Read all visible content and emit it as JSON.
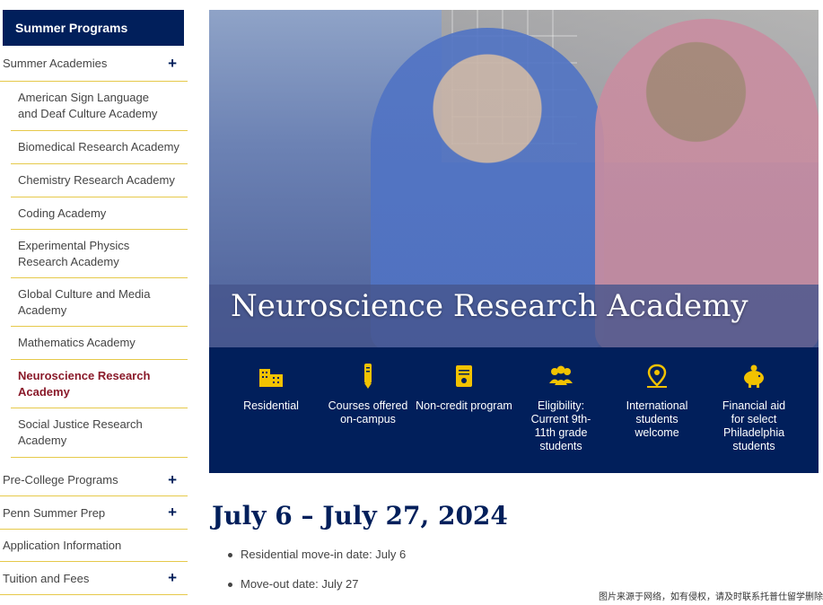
{
  "sidebar": {
    "title": "Summer Programs",
    "items": [
      {
        "label": "Summer Academies",
        "has_toggle": true
      },
      {
        "label": "American Sign Language and Deaf Culture Academy"
      },
      {
        "label": "Biomedical Research Academy"
      },
      {
        "label": "Chemistry Research Academy"
      },
      {
        "label": "Coding Academy"
      },
      {
        "label": "Experimental Physics Research Academy"
      },
      {
        "label": "Global Culture and Media Academy"
      },
      {
        "label": "Mathematics Academy"
      },
      {
        "label": "Neuroscience Research Academy",
        "active": true
      },
      {
        "label": "Social Justice Research Academy"
      },
      {
        "label": "Pre-College Programs",
        "has_toggle": true
      },
      {
        "label": "Penn Summer Prep",
        "has_toggle": true
      },
      {
        "label": "Application Information"
      },
      {
        "label": "Tuition and Fees",
        "has_toggle": true
      }
    ],
    "toggle_symbol": "+",
    "accent": "#011f5b",
    "active_color": "#8a1a2a",
    "divider_color": "#e6c94a"
  },
  "hero": {
    "title": "Neuroscience Research Academy"
  },
  "features": [
    {
      "icon": "building-icon",
      "label": "Residential"
    },
    {
      "icon": "pencil-icon",
      "label": "Courses offered on-campus"
    },
    {
      "icon": "certificate-icon",
      "label": "Non-credit program"
    },
    {
      "icon": "students-group-icon",
      "label": "Eligibility: Current 9th-11th grade students"
    },
    {
      "icon": "map-pin-icon",
      "label": "International students welcome"
    },
    {
      "icon": "piggy-bank-icon",
      "label": "Financial aid for select Philadelphia students"
    }
  ],
  "feature_icon_color": "#f2c200",
  "schedule": {
    "heading": "July 6 – July 27, 2024",
    "bullets": [
      "Residential move-in date: July 6",
      "Move-out date: July 27"
    ]
  },
  "watermark": "图片来源于网络，如有侵权，请及时联系托普仕留学删除"
}
